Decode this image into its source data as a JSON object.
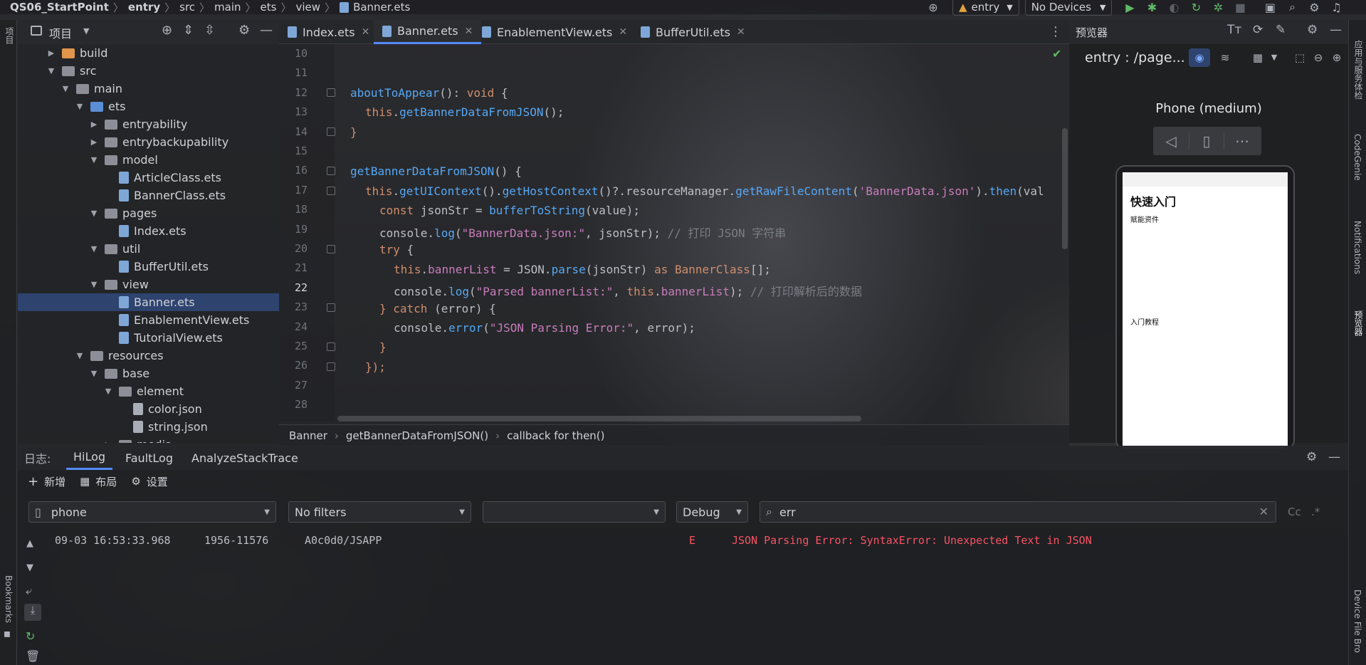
{
  "topbar": {
    "breadcrumb": [
      "QS06_StartPoint",
      "entry",
      "src",
      "main",
      "ets",
      "view",
      "Banner.ets"
    ],
    "module_selector": "entry",
    "device_selector": "No Devices"
  },
  "left_stripe": {
    "label": "项目"
  },
  "project_panel": {
    "title": "项目",
    "tree": [
      {
        "label": "build",
        "depth": 1,
        "kind": "folder-orange",
        "expanded": false
      },
      {
        "label": "src",
        "depth": 1,
        "kind": "folder",
        "expanded": true
      },
      {
        "label": "main",
        "depth": 2,
        "kind": "folder",
        "expanded": true
      },
      {
        "label": "ets",
        "depth": 3,
        "kind": "folder-blue",
        "expanded": true
      },
      {
        "label": "entryability",
        "depth": 4,
        "kind": "folder",
        "expanded": false
      },
      {
        "label": "entrybackupability",
        "depth": 4,
        "kind": "folder",
        "expanded": false
      },
      {
        "label": "model",
        "depth": 4,
        "kind": "folder",
        "expanded": true
      },
      {
        "label": "ArticleClass.ets",
        "depth": 5,
        "kind": "file"
      },
      {
        "label": "BannerClass.ets",
        "depth": 5,
        "kind": "file"
      },
      {
        "label": "pages",
        "depth": 4,
        "kind": "folder",
        "expanded": true
      },
      {
        "label": "Index.ets",
        "depth": 5,
        "kind": "file"
      },
      {
        "label": "util",
        "depth": 4,
        "kind": "folder",
        "expanded": true
      },
      {
        "label": "BufferUtil.ets",
        "depth": 5,
        "kind": "file"
      },
      {
        "label": "view",
        "depth": 4,
        "kind": "folder",
        "expanded": true
      },
      {
        "label": "Banner.ets",
        "depth": 5,
        "kind": "file",
        "selected": true
      },
      {
        "label": "EnablementView.ets",
        "depth": 5,
        "kind": "file"
      },
      {
        "label": "TutorialView.ets",
        "depth": 5,
        "kind": "file"
      },
      {
        "label": "resources",
        "depth": 3,
        "kind": "folder",
        "expanded": true
      },
      {
        "label": "base",
        "depth": 4,
        "kind": "folder",
        "expanded": true
      },
      {
        "label": "element",
        "depth": 5,
        "kind": "folder",
        "expanded": true
      },
      {
        "label": "color.json",
        "depth": 6,
        "kind": "json"
      },
      {
        "label": "string.json",
        "depth": 6,
        "kind": "json"
      },
      {
        "label": "media",
        "depth": 5,
        "kind": "folder",
        "expanded": false
      }
    ]
  },
  "editor": {
    "tabs": [
      {
        "label": "Index.ets",
        "active": false
      },
      {
        "label": "Banner.ets",
        "active": true
      },
      {
        "label": "EnablementView.ets",
        "active": false
      },
      {
        "label": "BufferUtil.ets",
        "active": false
      }
    ],
    "line_numbers": [
      "10",
      "11",
      "12",
      "13",
      "14",
      "15",
      "16",
      "17",
      "18",
      "19",
      "20",
      "21",
      "22",
      "23",
      "24",
      "25",
      "26",
      "27",
      "28"
    ],
    "current_line": "22",
    "code": {
      "l12": {
        "a": "aboutToAppear",
        "b": "(): ",
        "c": "void",
        "d": " {"
      },
      "l13": {
        "a": "this",
        "b": ".",
        "c": "getBannerDataFromJSON",
        "d": "();"
      },
      "l14": {
        "a": "}"
      },
      "l16": {
        "a": "getBannerDataFromJSON",
        "b": "() {"
      },
      "l17": {
        "a": "this",
        "b": ".",
        "c": "getUIContext",
        "d": "().",
        "e": "getHostContext",
        "f": "()?.resourceManager.",
        "g": "getRawFileContent",
        "h": "(",
        "i": "'BannerData.json'",
        "j": ").",
        "k": "then",
        "l": "(val"
      },
      "l18": {
        "a": "const",
        "b": " jsonStr = ",
        "c": "bufferToString",
        "d": "(value);"
      },
      "l19": {
        "a": "console.",
        "b": "log",
        "c": "(",
        "d": "\"BannerData.json:\"",
        "e": ", jsonStr); ",
        "f": "// 打印 JSON 字符串"
      },
      "l20": {
        "a": "try",
        "b": " {"
      },
      "l21": {
        "a": "this",
        "b": ".",
        "c": "bannerList",
        "d": " = JSON.",
        "e": "parse",
        "f": "(jsonStr) ",
        "g": "as",
        "h": " ",
        "i": "BannerClass",
        "j": "[];"
      },
      "l22": {
        "a": "console.",
        "b": "log",
        "c": "(",
        "d": "\"Parsed bannerList:\"",
        "e": ", ",
        "f": "this",
        "g": ".",
        "h": "bannerList",
        "i": "); ",
        "j": "// 打印解析后的数据"
      },
      "l23": {
        "a": "} ",
        "b": "catch",
        "c": " (error) {"
      },
      "l24": {
        "a": "console.",
        "b": "error",
        "c": "(",
        "d": "\"JSON Parsing Error:\"",
        "e": ", error);"
      },
      "l25": {
        "a": "}"
      },
      "l26": {
        "a": "});"
      }
    },
    "breadcrumb": [
      "Banner",
      "getBannerDataFromJSON()",
      "callback for then()"
    ]
  },
  "preview": {
    "panel_title": "预览器",
    "route": "entry : /page...",
    "device_name": "Phone (medium)",
    "app_title": "快速入门",
    "section1": "赋能资件",
    "section2": "入门教程"
  },
  "right_stripe": {
    "items": [
      "应用与服务体检",
      "CodeGenie",
      "Notifications",
      "预览器",
      "Device File Bro"
    ]
  },
  "bottom_left_stripe": {
    "label": "Bookmarks"
  },
  "log_panel": {
    "label": "日志:",
    "tabs": [
      {
        "label": "HiLog",
        "active": true
      },
      {
        "label": "FaultLog",
        "active": false
      },
      {
        "label": "AnalyzeStackTrace",
        "active": false
      }
    ],
    "toolbar": {
      "new": "新增",
      "layout": "布局",
      "settings": "设置"
    },
    "device_filter": "phone",
    "filter": "No filters",
    "process_filter": "",
    "level": "Debug",
    "search_value": "err",
    "case_label": "Cc",
    "regex_label": ".*",
    "entries": [
      {
        "time": "09-03 16:53:33.968",
        "pid": "1956-11576",
        "tag": "A0c0d0/JSAPP",
        "level": "E",
        "message": "JSON Parsing Error: SyntaxError: Unexpected Text in JSON"
      }
    ]
  },
  "colors": {
    "accent": "#548af7",
    "error": "#f75464",
    "selection": "#2e436e",
    "folder": "#8c8f97",
    "folder_blue": "#5a8fd6",
    "folder_orange": "#e0954a"
  }
}
